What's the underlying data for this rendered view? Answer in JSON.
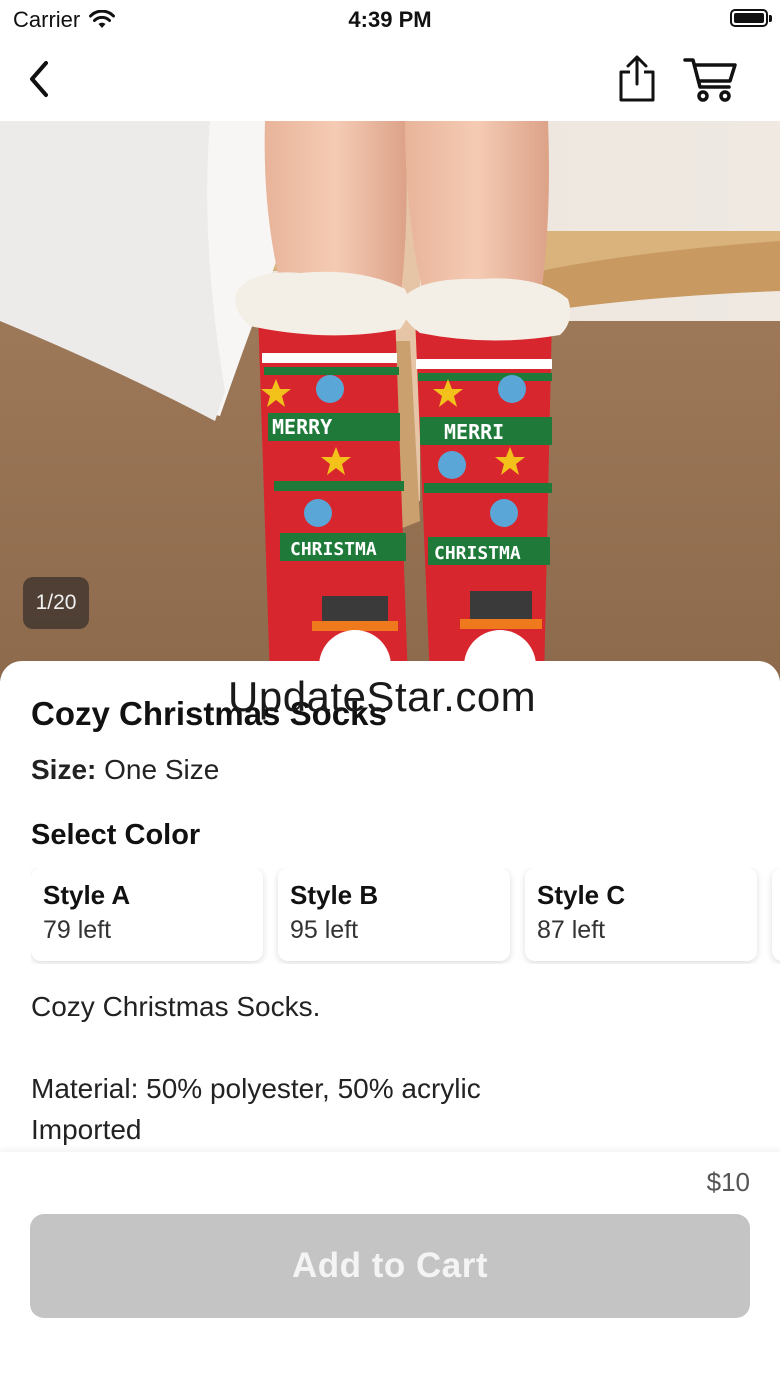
{
  "status_bar": {
    "carrier": "Carrier",
    "time": "4:39 PM"
  },
  "nav": {
    "back_icon": "chevron-left-icon",
    "share_icon": "share-icon",
    "cart_icon": "cart-icon"
  },
  "gallery": {
    "counter": "1/20"
  },
  "watermark": "UpdateStar.com",
  "product": {
    "title": "Cozy Christmas Socks",
    "size_label": "Size:",
    "size_value": "One Size",
    "color_heading": "Select Color",
    "colors": [
      {
        "name": "Style A",
        "stock": "79 left"
      },
      {
        "name": "Style B",
        "stock": "95 left"
      },
      {
        "name": "Style C",
        "stock": "87 left"
      }
    ],
    "description": {
      "line1": "Cozy Christmas Socks.",
      "line2": "Material: 50% polyester, 50% acrylic",
      "line3": "Imported"
    }
  },
  "purchase": {
    "price": "$10",
    "add_to_cart_label": "Add to Cart"
  },
  "colors": {
    "button_disabled": "#c4c4c4",
    "sock_red": "#d8262e",
    "sock_green": "#1f7a3a"
  }
}
